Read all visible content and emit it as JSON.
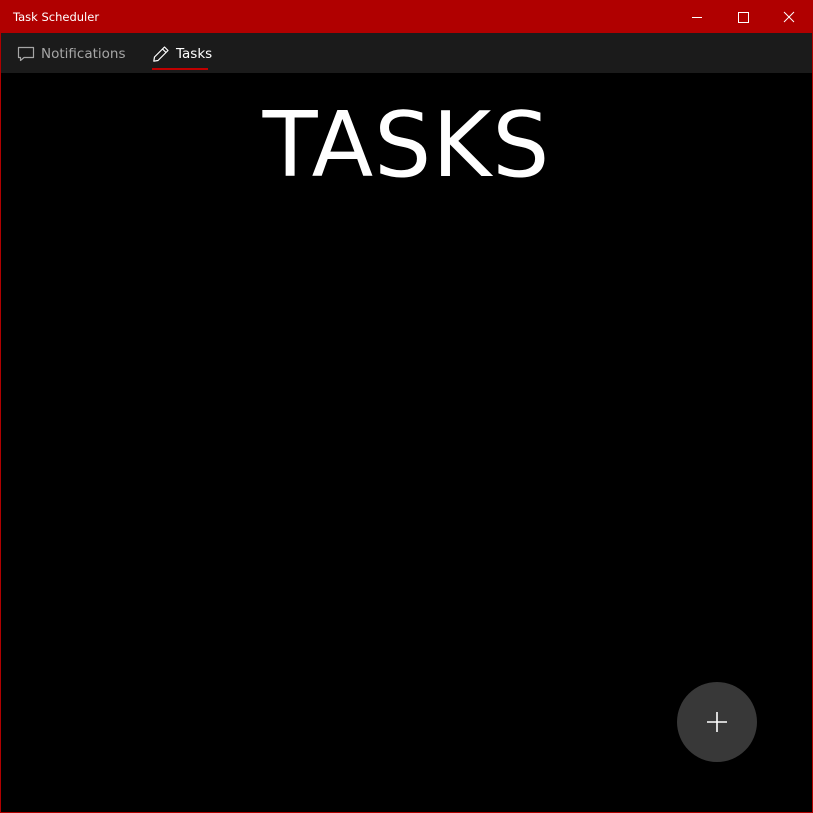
{
  "window": {
    "title": "Task Scheduler",
    "accent_color": "#b00000",
    "controls": {
      "minimize_icon": "minimize-icon",
      "maximize_icon": "maximize-icon",
      "close_icon": "close-icon"
    }
  },
  "nav": {
    "items": [
      {
        "label": "Notifications",
        "icon": "speech-bubble-icon",
        "selected": false
      },
      {
        "label": "Tasks",
        "icon": "pencil-icon",
        "selected": true
      }
    ],
    "selected_indicator_color": "#c00000"
  },
  "main": {
    "heading": "TASKS",
    "add_button_icon": "plus-icon"
  }
}
